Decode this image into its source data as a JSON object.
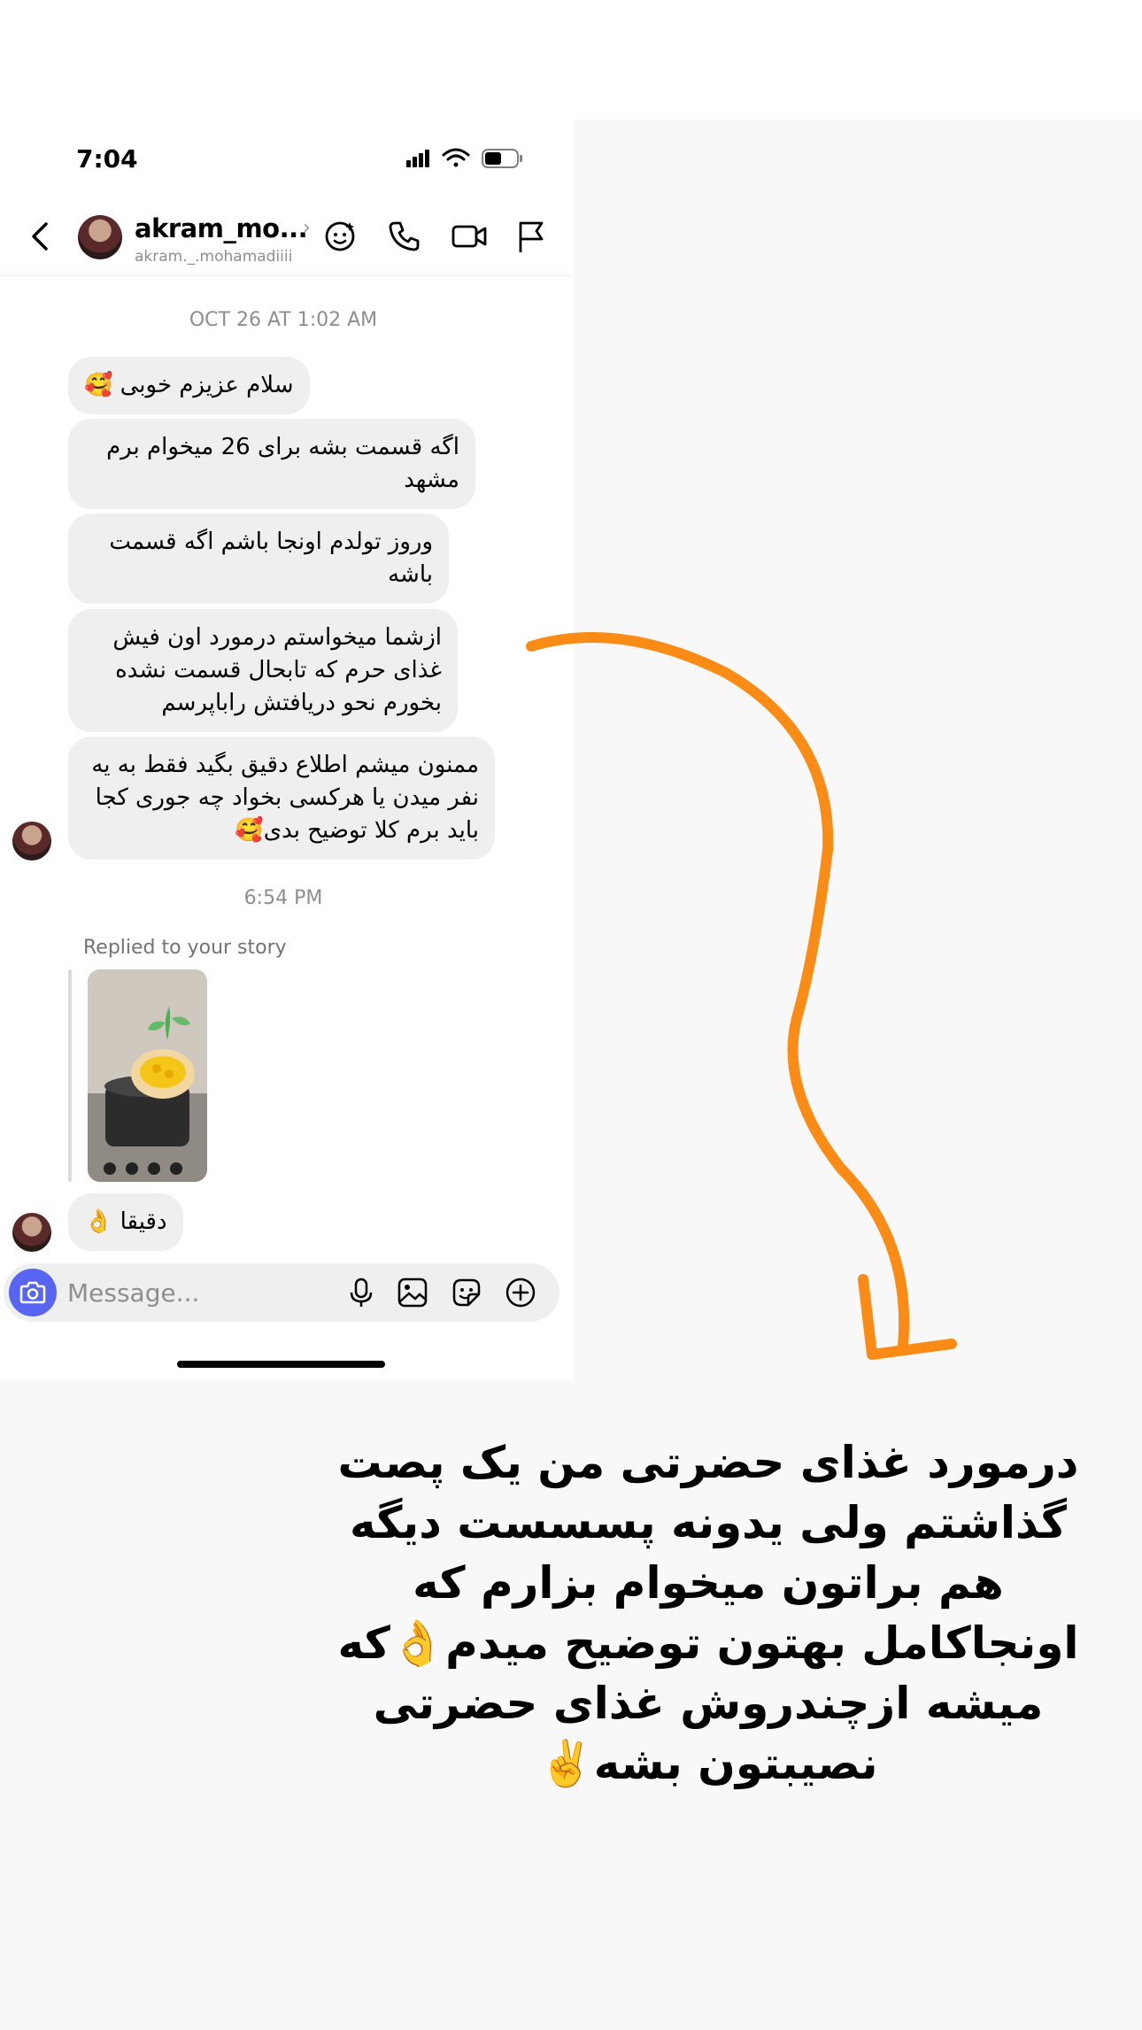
{
  "status": {
    "time": "7:04"
  },
  "header": {
    "name": "akram_mo...",
    "handle": "akram._.mohamadiiii"
  },
  "thread": {
    "date_separator": "OCT 26 AT 1:02 AM",
    "messages": [
      "سلام عزیزم خوبی 🥰",
      "اگه قسمت بشه برای 26 میخوام برم مشهد",
      "وروز تولدم اونجا باشم اگه قسمت باشه",
      "ازشما میخواستم درمورد اون فیش غذای حرم که تابحال قسمت نشده بخورم نحو دریافتش راباپرسم",
      "ممنون میشم اطلاع دقیق بگید فقط به یه نفر میدن یا هرکسی بخواد چه جوری کجا باید برم کلا توضیح بدی🥰"
    ],
    "time_separator": "6:54 PM",
    "reply_label": "Replied to your story",
    "reply_message": "دقیقا 👌"
  },
  "composer": {
    "placeholder": "Message..."
  },
  "caption": "درمورد غذای حضرتی من یک پصت گذاشتم ولی یدونه پسسست دیگه هم براتون میخوام بزارم که اونجاکامل بهتون توضیح میدم👌که میشه ازچندروش غذای حضرتی نصیبتون بشه✌️",
  "colors": {
    "arrow": "#fa8c16",
    "bubble": "#efefef",
    "camera_button": "#5865f2"
  }
}
